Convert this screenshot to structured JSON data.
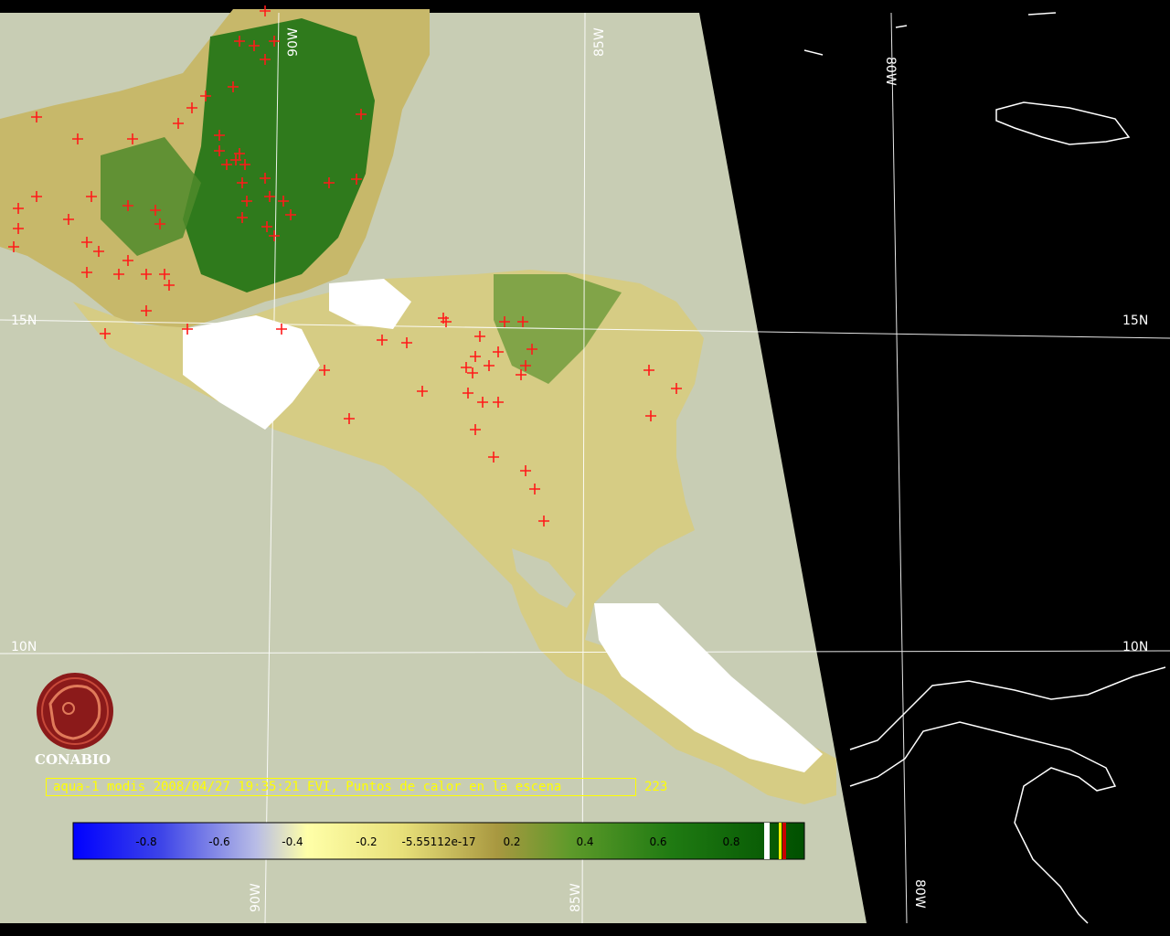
{
  "caption": {
    "text": "aqua-1 modis 2008/04/27 19:35:21 EVI, Puntos de calor en la escena",
    "count": "223"
  },
  "logo": {
    "name": "CONABIO"
  },
  "gridlines": {
    "longitude_labels": [
      "90W",
      "85W",
      "80W"
    ],
    "latitude_labels": [
      "15N",
      "10N"
    ]
  },
  "colorbar": {
    "ticks": [
      "-0.8",
      "-0.6",
      "-0.4",
      "-0.2",
      "-5.55112e-17",
      "0.2",
      "0.4",
      "0.6",
      "0.8"
    ]
  },
  "fire_points": {
    "count": 223,
    "color": "#ff1a1a"
  },
  "colors": {
    "ocean": "#c8cdb4",
    "background": "#000000",
    "caption": "#ffff00",
    "vegetation_dense": "#2e7d1c",
    "vegetation_sparse": "#d8cc82",
    "cloud": "#ffffff"
  }
}
